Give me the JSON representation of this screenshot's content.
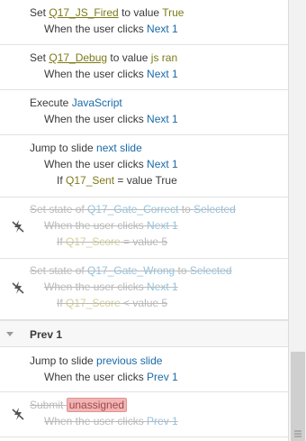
{
  "triggers": [
    {
      "line1": {
        "prefix": "Set ",
        "var": "Q17_JS_Fired",
        "mid": " to value ",
        "val": "True"
      },
      "line2": {
        "prefix": "When the user clicks ",
        "target": "Next 1"
      }
    },
    {
      "line1": {
        "prefix": "Set ",
        "var": "Q17_Debug",
        "mid": " to value ",
        "val": "js ran"
      },
      "line2": {
        "prefix": "When the user clicks ",
        "target": "Next 1"
      }
    },
    {
      "line1": {
        "prefix": "Execute ",
        "action": "JavaScript"
      },
      "line2": {
        "prefix": "When the user clicks ",
        "target": "Next 1"
      }
    },
    {
      "line1": {
        "prefix": "Jump to slide ",
        "action": "next slide"
      },
      "line2": {
        "prefix": "When the user clicks ",
        "target": "Next 1"
      },
      "line3": {
        "prefix": "If ",
        "var": "Q17_Sent",
        "cond": " = value True"
      }
    },
    {
      "line1": {
        "prefix": "Set state of ",
        "obj": "Q17_Gate_Correct",
        "mid": " to ",
        "state": "Selected"
      },
      "line2": {
        "prefix": "When the user clicks ",
        "target": "Next 1"
      },
      "line3": {
        "prefix": "If ",
        "var": "Q17_Score",
        "cond": " = value 5"
      }
    },
    {
      "line1": {
        "prefix": "Set state of ",
        "obj": "Q17_Gate_Wrong",
        "mid": " to ",
        "state": "Selected"
      },
      "line2": {
        "prefix": "When the user clicks ",
        "target": "Next 1"
      },
      "line3": {
        "prefix": "If ",
        "var": "Q17_Score",
        "cond": " < value 5"
      }
    }
  ],
  "section": {
    "title": "Prev 1"
  },
  "prev_triggers": [
    {
      "line1": {
        "prefix": "Jump to slide ",
        "action": "previous slide"
      },
      "line2": {
        "prefix": "When the user clicks ",
        "target": "Prev 1"
      }
    },
    {
      "line1": {
        "prefix": "Submit ",
        "badge": "unassigned"
      },
      "line2": {
        "prefix": "When the user clicks ",
        "target": "Prev 1"
      }
    }
  ],
  "icons": {
    "disabled": "lightning-disabled-icon",
    "caret": "caret-down-icon",
    "grip": "resize-grip-icon"
  },
  "colors": {
    "link": "#1a6aa8",
    "variable": "#7d7a18",
    "disabled_text": "#b9b9b9",
    "badge_bg": "#f1b5b5"
  }
}
